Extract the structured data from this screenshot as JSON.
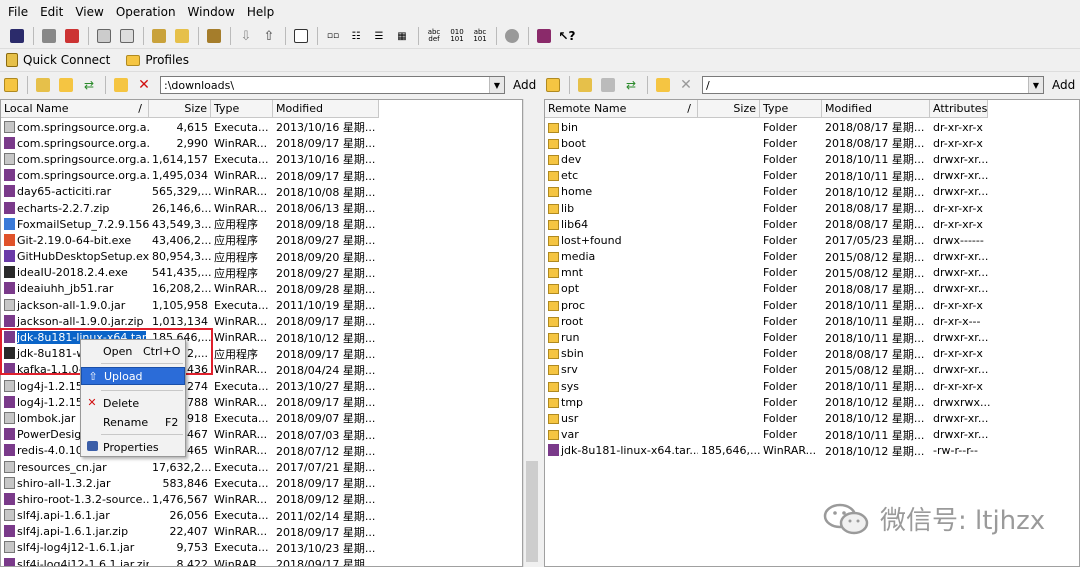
{
  "menu": [
    "File",
    "Edit",
    "View",
    "Operation",
    "Window",
    "Help"
  ],
  "bar2": {
    "quick_connect": "Quick Connect",
    "profiles": "Profiles"
  },
  "local": {
    "path": ":\\downloads\\",
    "add": "Add",
    "headers": [
      "Local Name",
      "/",
      "Size",
      "Type",
      "Modified"
    ],
    "rows": [
      [
        "com.springsource.org.a...",
        "4,615",
        "Executa...",
        "2013/10/16 星期...",
        "jar"
      ],
      [
        "com.springsource.org.a...",
        "2,990",
        "WinRAR...",
        "2018/09/17 星期...",
        "rar"
      ],
      [
        "com.springsource.org.a...",
        "1,614,157",
        "Executa...",
        "2013/10/16 星期...",
        "jar"
      ],
      [
        "com.springsource.org.a...",
        "1,495,034",
        "WinRAR...",
        "2018/09/17 星期...",
        "rar"
      ],
      [
        "day65-acticiti.rar",
        "565,329,...",
        "WinRAR...",
        "2018/10/08 星期...",
        "rar"
      ],
      [
        "echarts-2.2.7.zip",
        "26,146,6...",
        "WinRAR...",
        "2018/06/13 星期...",
        "rar"
      ],
      [
        "FoxmailSetup_7.2.9.156....",
        "43,549,3...",
        "应用程序",
        "2018/09/18 星期...",
        "exe1"
      ],
      [
        "Git-2.19.0-64-bit.exe",
        "43,406,2...",
        "应用程序",
        "2018/09/27 星期...",
        "exe2"
      ],
      [
        "GitHubDesktopSetup.exe",
        "80,954,3...",
        "应用程序",
        "2018/09/20 星期...",
        "exe3"
      ],
      [
        "ideaIU-2018.2.4.exe",
        "541,435,...",
        "应用程序",
        "2018/09/27 星期...",
        "exe4"
      ],
      [
        "ideaiuhh_jb51.rar",
        "16,208,2...",
        "WinRAR...",
        "2018/09/28 星期...",
        "rar"
      ],
      [
        "jackson-all-1.9.0.jar",
        "1,105,958",
        "Executa...",
        "2011/10/19 星期...",
        "jar"
      ],
      [
        "jackson-all-1.9.0.jar.zip",
        "1,013,134",
        "WinRAR...",
        "2018/09/17 星期...",
        "rar"
      ],
      [
        "jdk-8u181-linux-x64.tar....",
        "185,646,...",
        "WinRAR...",
        "2018/10/12 星期...",
        "rar"
      ],
      [
        "jdk-8u181-windows-x64.exe",
        "214,652,...",
        "应用程序",
        "2018/09/17 星期...",
        "exe4"
      ],
      [
        "kafka-1.1.0-src.tgz",
        "7,436",
        "WinRAR...",
        "2018/04/24 星期...",
        "rar"
      ],
      [
        "log4j-1.2.15.jar",
        "391,274",
        "Executa...",
        "2013/10/27 星期...",
        "jar"
      ],
      [
        "log4j-1.2.15.jar.zip",
        "361,788",
        "WinRAR...",
        "2018/09/17 星期...",
        "rar"
      ],
      [
        "lombok.jar",
        "1,575,918",
        "Executa...",
        "2018/09/07 星期...",
        "jar"
      ],
      [
        "PowerDesigner.rar",
        "75,467",
        "WinRAR...",
        "2018/07/03 星期...",
        "rar"
      ],
      [
        "redis-4.0.10.tar.gz",
        "1,738,465",
        "WinRAR...",
        "2018/07/12 星期...",
        "rar"
      ],
      [
        "resources_cn.jar",
        "17,632,2...",
        "Executa...",
        "2017/07/21 星期...",
        "jar"
      ],
      [
        "shiro-all-1.3.2.jar",
        "583,846",
        "Executa...",
        "2018/09/17 星期...",
        "jar"
      ],
      [
        "shiro-root-1.3.2-source...",
        "1,476,567",
        "WinRAR...",
        "2018/09/12 星期...",
        "rar"
      ],
      [
        "slf4j.api-1.6.1.jar",
        "26,056",
        "Executa...",
        "2011/02/14 星期...",
        "jar"
      ],
      [
        "slf4j.api-1.6.1.jar.zip",
        "22,407",
        "WinRAR...",
        "2018/09/17 星期...",
        "rar"
      ],
      [
        "slf4j-log4j12-1.6.1.jar",
        "9,753",
        "Executa...",
        "2013/10/23 星期...",
        "jar"
      ],
      [
        "slf4j-log4j12-1.6.1.jar.zip",
        "8,422",
        "WinRAR...",
        "2018/09/17 星期...",
        "rar"
      ]
    ],
    "visible_names": [
      "com.springsource.org.a...",
      "com.springsource.org.a...",
      "com.springsource.org.a...",
      "com.springsource.org.a...",
      "day65-acticiti.rar",
      "echarts-2.2.7.zip",
      "FoxmailSetup_7.2.9.156....",
      "Git-2.19.0-64-bit.exe",
      "GitHubDesktopSetup.exe",
      "ideaIU-2018.2.4.exe",
      "ideaiuhh_jb51.rar",
      "jackson-all-1.9.0.jar",
      "jackson-all-1.9.0.jar.zip",
      "jdk-8u181-linux-x64.tar",
      "jdk-8u181-wi",
      "kafka-1.1.0-s",
      "log4j-1.2.15j",
      "log4j-1.2.15.j",
      "lombok.jar",
      "PowerDesign",
      "redis-4.0.10.t",
      "resources_cn.jar",
      "shiro-all-1.3.2.jar",
      "shiro-root-1.3.2-source...",
      "slf4j.api-1.6.1.jar",
      "slf4j.api-1.6.1.jar.zip",
      "slf4j-log4j12-1.6.1.jar",
      "slf4j-log4j12-1.6.1.jar.zip"
    ],
    "visible_sizes": [
      "4,615",
      "2,990",
      "1,614,157",
      "1,495,034",
      "565,329,...",
      "26,146,6...",
      "43,549,3...",
      "43,406,2...",
      "80,954,3...",
      "541,435,...",
      "16,208,2...",
      "1,105,958",
      "1,013,134",
      "185,646,...",
      "2,...",
      "436",
      "274",
      "788",
      "918",
      "467",
      "465",
      "17,632,2...",
      "583,846",
      "1,476,567",
      "26,056",
      "22,407",
      "9,753",
      "8,422"
    ]
  },
  "remote": {
    "path": "/",
    "add": "Add",
    "headers": [
      "Remote Name",
      "/",
      "Size",
      "Type",
      "Modified",
      "Attributes"
    ],
    "rows": [
      [
        "bin",
        "",
        "Folder",
        "2018/08/17 星期...",
        "dr-xr-xr-x"
      ],
      [
        "boot",
        "",
        "Folder",
        "2018/08/17 星期...",
        "dr-xr-xr-x"
      ],
      [
        "dev",
        "",
        "Folder",
        "2018/10/11 星期...",
        "drwxr-xr..."
      ],
      [
        "etc",
        "",
        "Folder",
        "2018/10/11 星期...",
        "drwxr-xr..."
      ],
      [
        "home",
        "",
        "Folder",
        "2018/10/12 星期...",
        "drwxr-xr..."
      ],
      [
        "lib",
        "",
        "Folder",
        "2018/08/17 星期...",
        "dr-xr-xr-x"
      ],
      [
        "lib64",
        "",
        "Folder",
        "2018/08/17 星期...",
        "dr-xr-xr-x"
      ],
      [
        "lost+found",
        "",
        "Folder",
        "2017/05/23 星期...",
        "drwx------"
      ],
      [
        "media",
        "",
        "Folder",
        "2015/08/12 星期...",
        "drwxr-xr..."
      ],
      [
        "mnt",
        "",
        "Folder",
        "2015/08/12 星期...",
        "drwxr-xr..."
      ],
      [
        "opt",
        "",
        "Folder",
        "2018/08/17 星期...",
        "drwxr-xr..."
      ],
      [
        "proc",
        "",
        "Folder",
        "2018/10/11 星期...",
        "dr-xr-xr-x"
      ],
      [
        "root",
        "",
        "Folder",
        "2018/10/11 星期...",
        "dr-xr-x---"
      ],
      [
        "run",
        "",
        "Folder",
        "2018/10/11 星期...",
        "drwxr-xr..."
      ],
      [
        "sbin",
        "",
        "Folder",
        "2018/08/17 星期...",
        "dr-xr-xr-x"
      ],
      [
        "srv",
        "",
        "Folder",
        "2015/08/12 星期...",
        "drwxr-xr..."
      ],
      [
        "sys",
        "",
        "Folder",
        "2018/10/11 星期...",
        "dr-xr-xr-x"
      ],
      [
        "tmp",
        "",
        "Folder",
        "2018/10/12 星期...",
        "drwxrwx..."
      ],
      [
        "usr",
        "",
        "Folder",
        "2018/10/12 星期...",
        "drwxr-xr..."
      ],
      [
        "var",
        "",
        "Folder",
        "2018/10/11 星期...",
        "drwxr-xr..."
      ],
      [
        "jdk-8u181-linux-x64.tar....",
        "185,646,...",
        "WinRAR...",
        "2018/10/12 星期...",
        "-rw-r--r--"
      ]
    ]
  },
  "context_menu": {
    "open": "Open",
    "open_key": "Ctrl+O",
    "upload": "Upload",
    "delete": "Delete",
    "rename": "Rename",
    "rename_key": "F2",
    "properties": "Properties"
  },
  "watermark": "微信号: ltjhzx",
  "colors": {
    "selection": "#0a64c8",
    "highlight": "#e0202c",
    "folder": "#f5c542"
  }
}
